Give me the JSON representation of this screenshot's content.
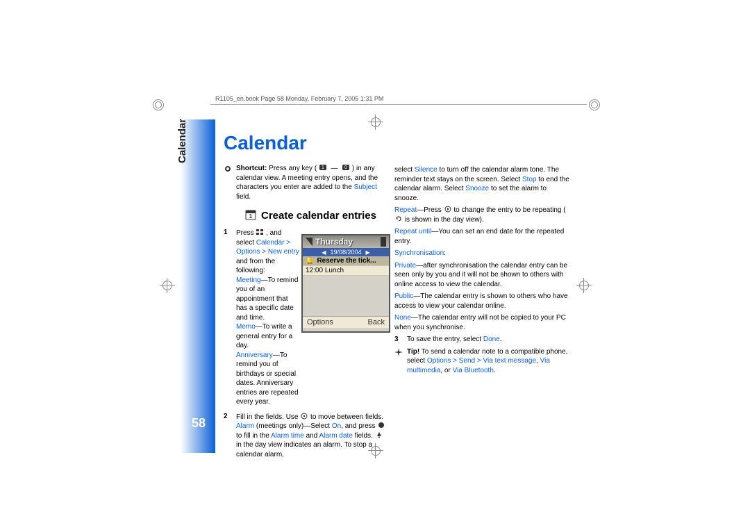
{
  "header_line": "R1105_en.book  Page 58  Monday, February 7, 2005  1:31 PM",
  "vertical_label": "Calendar",
  "page_number": "58",
  "title": "Calendar",
  "shortcut": {
    "bold": "Shortcut:",
    "a": " Press any key (",
    "keys": "1 — 0",
    "b": ") in any calendar view. A meeting entry opens, and the characters you enter are added to the ",
    "subject": "Subject",
    "c": " field."
  },
  "section_title": "Create calendar entries",
  "step1": {
    "a": "Press ",
    "b": " , and select ",
    "path": "Calendar > Options > New entry",
    "c": " and from the following:",
    "meeting_l": "Meeting",
    "meeting_t": "—To remind you of an appointment that has a specific date and time.",
    "memo_l": "Memo",
    "memo_t": "—To write a general entry for a day.",
    "anniv_l": "Anniversary",
    "anniv_t": "—To remind you of birthdays or special dates. Anniversary entries are repeated every year."
  },
  "step2": {
    "a": "Fill in the fields. Use ",
    "b": " to move between fields.",
    "alarm_l": "Alarm",
    "alarm_t1": " (meetings only)—Select ",
    "on": "On",
    "alarm_t2": ", and press ",
    "alarm_t3": " to fill in the ",
    "at": "Alarm time",
    "and": " and ",
    "ad": "Alarm date",
    "alarm_t4": " fields. ",
    "alarm_t5": " in the day view indicates an alarm. To stop a calendar alarm,"
  },
  "right": {
    "a1": "select ",
    "silence": "Silence",
    "a2": " to turn off the calendar alarm tone. The reminder text stays on the screen. Select ",
    "stop": "Stop",
    "a3": " to end the calendar alarm. Select ",
    "snooze": "Snooze",
    "a4": " to set the alarm to snooze.",
    "repeat_l": "Repeat",
    "repeat_t1": "—Press ",
    "repeat_t2": " to change the entry to be repeating (",
    "repeat_t3": " is shown in the day view).",
    "ru_l": "Repeat until",
    "ru_t": "—You can set an end date for the repeated entry.",
    "sync_l": "Synchronisation",
    "priv_l": "Private",
    "priv_t": "—after synchronisation the calendar entry can be seen only by you and it will not be shown to others with online access to view the calendar.",
    "pub_l": "Public",
    "pub_t": "—The calendar entry is shown to others who have access to view your calendar online.",
    "none_l": "None",
    "none_t": "—The calendar entry will not be copied to your PC when you synchronise."
  },
  "step3": {
    "a": "To save the entry, select ",
    "done": "Done",
    "dot": "."
  },
  "tip": {
    "bold": "Tip!",
    "a": " To send a calendar note to a compatible phone, select ",
    "path1": "Options > Send > Via text message",
    "comma": ", ",
    "path2": "Via multimedia",
    "or": ", or ",
    "path3": "Via Bluetooth",
    "dot": "."
  },
  "phone": {
    "day": "Thursday",
    "date": "19/08/2004",
    "entry1": "Reserve the tick...",
    "entry2_time": "12:00",
    "entry2": "Lunch",
    "left": "Options",
    "right": "Back"
  }
}
